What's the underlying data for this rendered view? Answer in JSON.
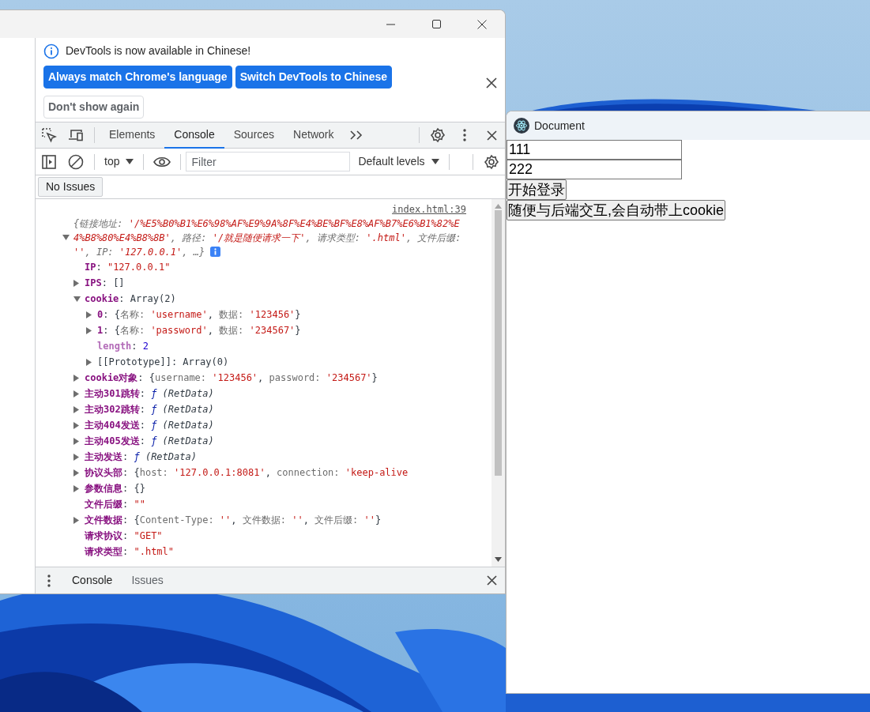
{
  "devtools_window": {
    "infobar": {
      "message": "DevTools is now available in Chinese!",
      "buttons": [
        {
          "label": "Always match Chrome's language",
          "kind": "primary"
        },
        {
          "label": "Switch DevTools to Chinese",
          "kind": "primary"
        },
        {
          "label": "Don't show again",
          "kind": "secondary"
        }
      ]
    },
    "tabs": [
      {
        "label": "Elements",
        "selected": false
      },
      {
        "label": "Console",
        "selected": true
      },
      {
        "label": "Sources",
        "selected": false
      },
      {
        "label": "Network",
        "selected": false
      }
    ],
    "console_toolbar": {
      "context": "top",
      "filter_placeholder": "Filter",
      "levels": "Default levels"
    },
    "issues_button": "No Issues",
    "log": {
      "source": "index.html:39",
      "expanded": true,
      "summary": [
        {
          "kind": "dim",
          "text": "{链接地址: "
        },
        {
          "kind": "string",
          "text": "'/%E5%B0%B1%E6%98%AF%E9%9A%8F%E4%BE%BF%E8%AF%B7%E6%B1%82%E4%B8%80%E4%B8%8B'"
        },
        {
          "kind": "dim",
          "text": ", 路径: "
        },
        {
          "kind": "string",
          "text": "'/就是随便请求一下'"
        },
        {
          "kind": "dim",
          "text": ", 请求类型: "
        },
        {
          "kind": "string",
          "text": "'.html'"
        },
        {
          "kind": "dim",
          "text": ", 文件后缀: "
        },
        {
          "kind": "string",
          "text": "''"
        },
        {
          "kind": "dim",
          "text": ", IP: "
        },
        {
          "kind": "string",
          "text": "'127.0.0.1'"
        },
        {
          "kind": "dim",
          "text": ", …}"
        }
      ],
      "properties": [
        {
          "key": "IP",
          "kind": "own",
          "expandable": false,
          "value": [
            {
              "kind": "text",
              "text": ": "
            },
            {
              "kind": "string",
              "text": "\"127.0.0.1\""
            }
          ]
        },
        {
          "key": "IPS",
          "kind": "own",
          "expandable": true,
          "expanded": false,
          "value": [
            {
              "kind": "text",
              "text": ": []"
            }
          ]
        },
        {
          "key": "cookie",
          "kind": "own",
          "expandable": true,
          "expanded": true,
          "value": [
            {
              "kind": "text",
              "text": ": Array(2)"
            }
          ],
          "children": [
            {
              "key": "0",
              "kind": "own",
              "expandable": true,
              "expanded": false,
              "value": [
                {
                  "kind": "text",
                  "text": ": {"
                },
                {
                  "kind": "dim",
                  "text": "名称: "
                },
                {
                  "kind": "string",
                  "text": "'username'"
                },
                {
                  "kind": "text",
                  "text": ", "
                },
                {
                  "kind": "dim",
                  "text": "数据: "
                },
                {
                  "kind": "string",
                  "text": "'123456'"
                },
                {
                  "kind": "text",
                  "text": "}"
                }
              ]
            },
            {
              "key": "1",
              "kind": "own",
              "expandable": true,
              "expanded": false,
              "value": [
                {
                  "kind": "text",
                  "text": ": {"
                },
                {
                  "kind": "dim",
                  "text": "名称: "
                },
                {
                  "kind": "string",
                  "text": "'password'"
                },
                {
                  "kind": "text",
                  "text": ", "
                },
                {
                  "kind": "dim",
                  "text": "数据: "
                },
                {
                  "kind": "string",
                  "text": "'234567'"
                },
                {
                  "kind": "text",
                  "text": "}"
                }
              ]
            },
            {
              "key": "length",
              "kind": "hidden",
              "expandable": false,
              "value": [
                {
                  "kind": "text",
                  "text": ": "
                },
                {
                  "kind": "number",
                  "text": "2"
                }
              ]
            },
            {
              "key": "[[Prototype]]",
              "kind": "internal",
              "expandable": true,
              "expanded": false,
              "value": [
                {
                  "kind": "text",
                  "text": ": Array(0)"
                }
              ]
            }
          ]
        },
        {
          "key": "cookie对象",
          "kind": "own",
          "expandable": true,
          "expanded": false,
          "value": [
            {
              "kind": "text",
              "text": ": {"
            },
            {
              "kind": "dim",
              "text": "username: "
            },
            {
              "kind": "string",
              "text": "'123456'"
            },
            {
              "kind": "text",
              "text": ", "
            },
            {
              "kind": "dim",
              "text": "password: "
            },
            {
              "kind": "string",
              "text": "'234567'"
            },
            {
              "kind": "text",
              "text": "}"
            }
          ]
        },
        {
          "key": "主动301跳转",
          "kind": "own",
          "expandable": true,
          "expanded": false,
          "value": [
            {
              "kind": "text",
              "text": ": "
            },
            {
              "kind": "func",
              "text": "ƒ"
            },
            {
              "kind": "italic",
              "text": " (RetData)"
            }
          ]
        },
        {
          "key": "主动302跳转",
          "kind": "own",
          "expandable": true,
          "expanded": false,
          "value": [
            {
              "kind": "text",
              "text": ": "
            },
            {
              "kind": "func",
              "text": "ƒ"
            },
            {
              "kind": "italic",
              "text": " (RetData)"
            }
          ]
        },
        {
          "key": "主动404发送",
          "kind": "own",
          "expandable": true,
          "expanded": false,
          "value": [
            {
              "kind": "text",
              "text": ": "
            },
            {
              "kind": "func",
              "text": "ƒ"
            },
            {
              "kind": "italic",
              "text": " (RetData)"
            }
          ]
        },
        {
          "key": "主动405发送",
          "kind": "own",
          "expandable": true,
          "expanded": false,
          "value": [
            {
              "kind": "text",
              "text": ": "
            },
            {
              "kind": "func",
              "text": "ƒ"
            },
            {
              "kind": "italic",
              "text": " (RetData)"
            }
          ]
        },
        {
          "key": "主动发送",
          "kind": "own",
          "expandable": true,
          "expanded": false,
          "value": [
            {
              "kind": "text",
              "text": ": "
            },
            {
              "kind": "func",
              "text": "ƒ"
            },
            {
              "kind": "italic",
              "text": " (RetData)"
            }
          ]
        },
        {
          "key": "协议头部",
          "kind": "own",
          "expandable": true,
          "expanded": false,
          "value": [
            {
              "kind": "text",
              "text": ": {"
            },
            {
              "kind": "dim",
              "text": "host: "
            },
            {
              "kind": "string",
              "text": "'127.0.0.1:8081'"
            },
            {
              "kind": "text",
              "text": ", "
            },
            {
              "kind": "dim",
              "text": "connection: "
            },
            {
              "kind": "string",
              "text": "'keep-alive"
            }
          ]
        },
        {
          "key": "参数信息",
          "kind": "own",
          "expandable": true,
          "expanded": false,
          "value": [
            {
              "kind": "text",
              "text": ": {}"
            }
          ]
        },
        {
          "key": "文件后缀",
          "kind": "own",
          "expandable": false,
          "value": [
            {
              "kind": "text",
              "text": ": "
            },
            {
              "kind": "string",
              "text": "\"\""
            }
          ]
        },
        {
          "key": "文件数据",
          "kind": "own",
          "expandable": true,
          "expanded": false,
          "value": [
            {
              "kind": "text",
              "text": ": {"
            },
            {
              "kind": "dim",
              "text": "Content-Type: "
            },
            {
              "kind": "string",
              "text": "''"
            },
            {
              "kind": "text",
              "text": ", "
            },
            {
              "kind": "dim",
              "text": "文件数据: "
            },
            {
              "kind": "string",
              "text": "''"
            },
            {
              "kind": "text",
              "text": ", "
            },
            {
              "kind": "dim",
              "text": "文件后缀: "
            },
            {
              "kind": "string",
              "text": "''"
            },
            {
              "kind": "text",
              "text": "}"
            }
          ]
        },
        {
          "key": "请求协议",
          "kind": "own",
          "expandable": false,
          "value": [
            {
              "kind": "text",
              "text": ": "
            },
            {
              "kind": "string",
              "text": "\"GET\""
            }
          ]
        },
        {
          "key": "请求类型",
          "kind": "own",
          "expandable": false,
          "value": [
            {
              "kind": "text",
              "text": ": "
            },
            {
              "kind": "string",
              "text": "\".html\""
            }
          ]
        }
      ]
    },
    "drawer_tabs": [
      {
        "label": "Console",
        "selected": true
      },
      {
        "label": "Issues",
        "selected": false
      }
    ]
  },
  "app_window": {
    "title": "Document",
    "fields": [
      {
        "value": "111"
      },
      {
        "value": "222"
      }
    ],
    "buttons": [
      "开始登录",
      "随便与后端交互,会自动带上cookie"
    ]
  }
}
